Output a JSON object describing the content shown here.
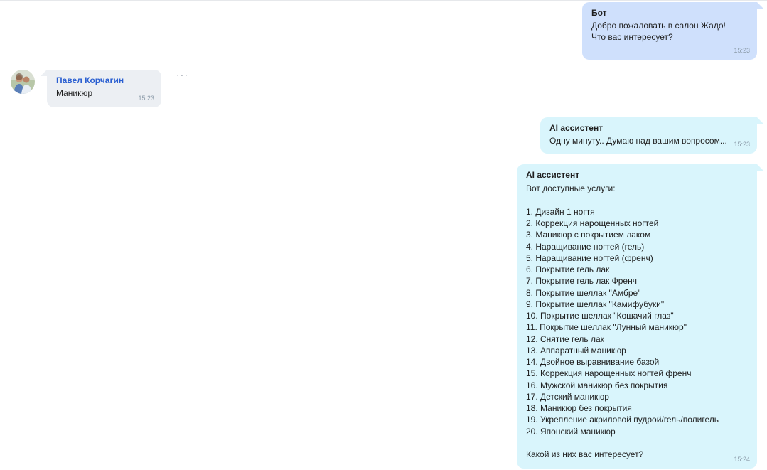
{
  "messages": [
    {
      "sender": "Бот",
      "text": "Добро пожаловать в салон Жадо!\nЧто вас интересует?",
      "time": "15:23"
    },
    {
      "sender": "Павел Корчагин",
      "text": "Маникюр",
      "time": "15:23"
    },
    {
      "sender": "AI ассистент",
      "text": "Одну минуту.. Думаю над вашим вопросом...",
      "time": "15:23"
    },
    {
      "sender": "AI ассистент",
      "text": "Вот доступные услуги:\n\n1. Дизайн 1 ногтя\n2. Коррекция нарощенных ногтей\n3. Маникюр с покрытием лаком\n4. Наращивание ногтей (гель)\n5. Наращивание ногтей (френч)\n6. Покрытие гель лак\n7. Покрытие гель лак Френч\n8. Покрытие шеллак \"Амбре\"\n9. Покрытие шеллак \"Камифубуки\"\n10. Покрытие шеллак \"Кошачий глаз\"\n11. Покрытие шеллак \"Лунный маникюр\"\n12. Снятие гель лак\n13. Аппаратный маникюр\n14. Двойное выравнивание базой\n15. Коррекция нарощенных ногтей френч\n16. Мужской маникюр без покрытия\n17. Детский маникюр\n18. Маникюр без покрытия\n19. Укрепление акриловой пудрой/гель/полигель\n20. Японский маникюр\n\nКакой из них вас интересует?",
      "time": "15:24"
    }
  ],
  "more_icon": "more-dots-icon",
  "colors": {
    "bot_bubble": "#cfe0fc",
    "user_bubble": "#eceff3",
    "ai_bubble": "#d9f5fc",
    "user_name": "#2a5fd1",
    "time": "#8a9aa8"
  }
}
